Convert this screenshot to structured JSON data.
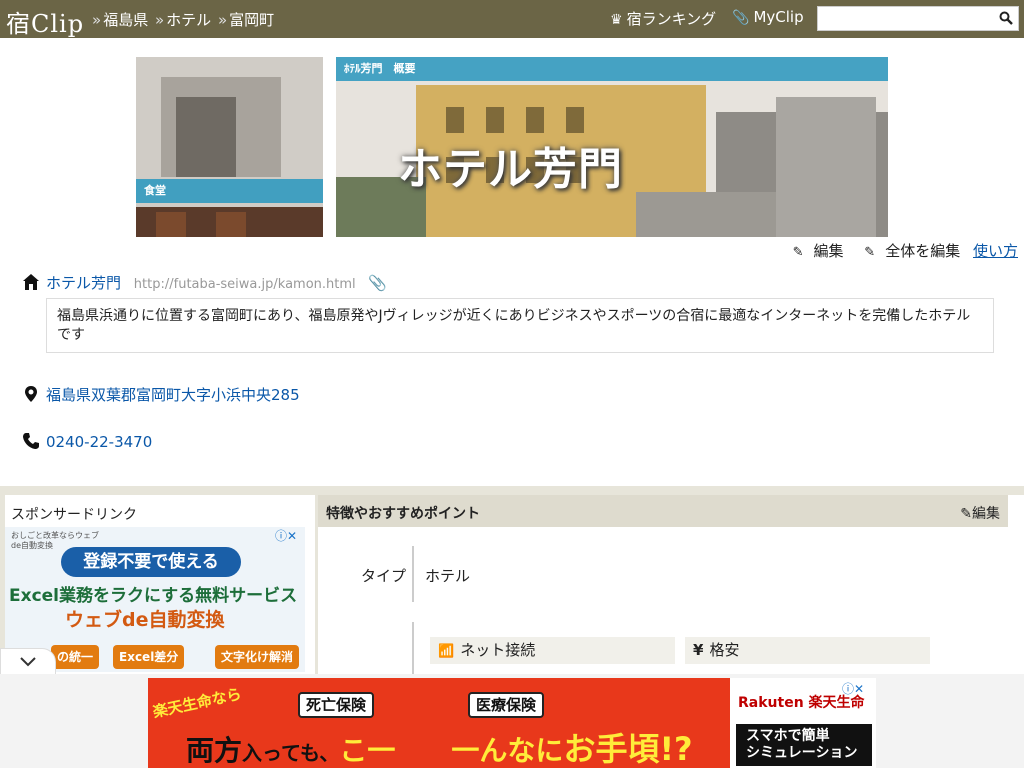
{
  "header": {
    "logo_text_a": "宿C",
    "logo_text_b": "lip",
    "breadcrumbs": [
      "福島県",
      "ホテル",
      "富岡町"
    ],
    "separator": "»",
    "ranking_label": "宿ランキング",
    "myclip_label": "MyClip",
    "search_placeholder": ""
  },
  "photos": {
    "left_caption": "食堂",
    "main_caption": "ﾎﾃﾙ芳門　概要",
    "main_overlay": "ホテル芳門"
  },
  "edit_bar": {
    "edit": "編集",
    "edit_all": "全体を編集",
    "howto": "使い方"
  },
  "hotel": {
    "name": "ホテル芳門",
    "url": "http://futaba-seiwa.jp/kamon.html",
    "description": "福島県浜通りに位置する富岡町にあり、福島原発やJヴィレッジが近くにありビジネスやスポーツの合宿に最適なインターネットを完備したホテルです",
    "address": "福島県双葉郡富岡町大字小浜中央285",
    "phone": "0240-22-3470"
  },
  "sponsor": {
    "heading": "スポンサードリンク",
    "ad_line1": "登録不要で使える",
    "ad_line2": "Excel業務をラクにする無料サービス",
    "ad_line3": "ウェブde自動変換",
    "ad_chip1": "の統一",
    "ad_chip2": "Excel差分",
    "ad_chip3": "文字化け解消",
    "ad_top": "おしごと改革ならウェブde自動変換"
  },
  "features": {
    "heading": "特徴やおすすめポイント",
    "edit": "編集",
    "type_label": "タイプ",
    "type_value": "ホテル",
    "tags": [
      "ネット接続",
      "格安"
    ]
  },
  "bottom_ad": {
    "left_text": "楽天生命なら",
    "box1": "死亡保険",
    "box2": "医療保険",
    "main_a": "両方",
    "main_b": "入っても、",
    "main_c": "こ一　　一んなに",
    "main_d": "お手頃!?",
    "brand": "Rakuten 楽天生命",
    "cta": "スマホで簡単\nシミュレーション"
  },
  "colors": {
    "header_bg": "#6b6546",
    "link": "#0a57a8",
    "band": "#e7e5da"
  }
}
